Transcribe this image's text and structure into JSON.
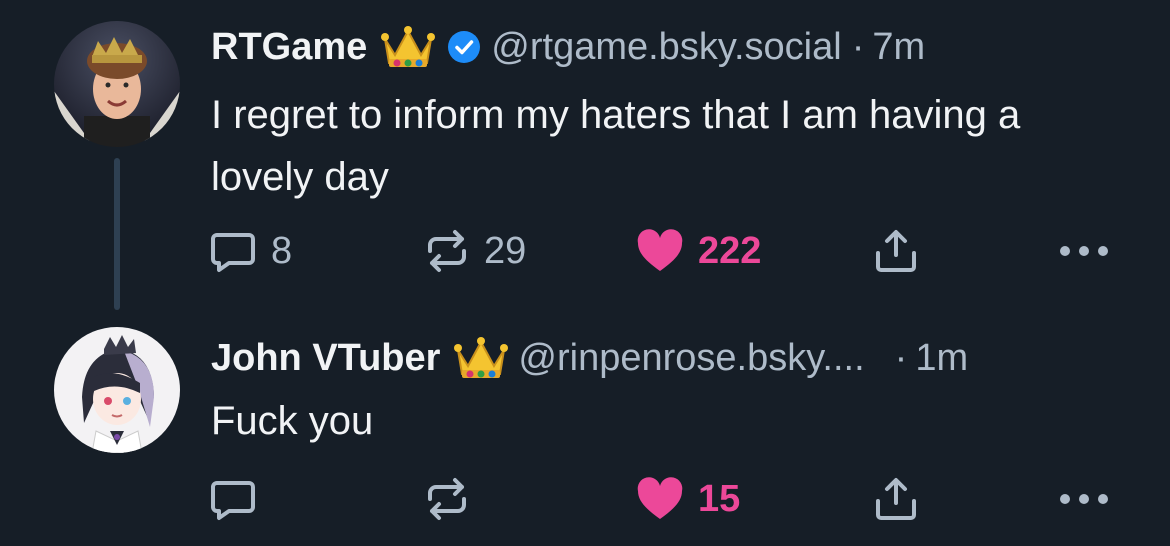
{
  "posts": [
    {
      "author_name": "RTGame",
      "handle": "@rtgame.bsky.social",
      "separator": "·",
      "time": "7m",
      "text": "I regret to inform my haters that I am having a lovely day",
      "verified": true,
      "badge_icon": "crown-icon",
      "reply_count": "8",
      "repost_count": "29",
      "like_count": "222",
      "liked": true
    },
    {
      "author_name": "John VTuber",
      "handle": "@rinpenrose.bsky....",
      "separator": "·",
      "time": "1m",
      "text": "Fuck you",
      "verified": false,
      "badge_icon": "crown-icon",
      "reply_count": "",
      "repost_count": "",
      "like_count": "15",
      "liked": true
    }
  ],
  "colors": {
    "background": "#161e27",
    "text": "#f1f3f5",
    "muted": "#aebbc9",
    "like": "#ec4899",
    "verified": "#1d8cf8",
    "thread_line": "#2e4052"
  }
}
